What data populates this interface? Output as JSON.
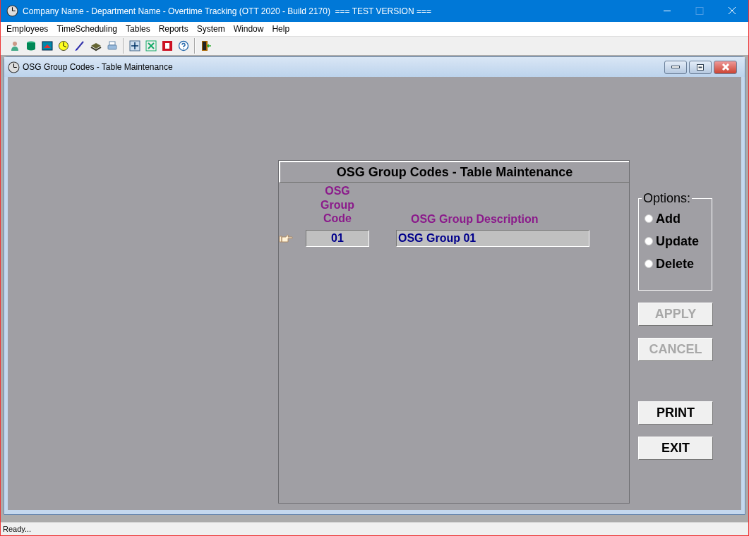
{
  "window": {
    "title": "Company Name - Department Name - Overtime Tracking (OTT 2020 - Build 2170)  === TEST VERSION ==="
  },
  "menu": [
    "Employees",
    "TimeScheduling",
    "Tables",
    "Reports",
    "System",
    "Window",
    "Help"
  ],
  "child_window": {
    "title": "OSG Group Codes - Table Maintenance"
  },
  "form": {
    "heading": "OSG Group Codes - Table Maintenance",
    "columns": [
      "OSG Group Code",
      "OSG Group Description"
    ],
    "rows": [
      {
        "code": "01",
        "description": "OSG Group 01",
        "current": true
      }
    ]
  },
  "options": {
    "legend": "Options:",
    "items": [
      {
        "label": "Add",
        "selected": false
      },
      {
        "label": "Update",
        "selected": false
      },
      {
        "label": "Delete",
        "selected": false
      }
    ]
  },
  "buttons": [
    {
      "label": "APPLY",
      "disabled": true
    },
    {
      "label": "CANCEL",
      "disabled": true
    },
    {
      "label": "PRINT",
      "disabled": false
    },
    {
      "label": "EXIT",
      "disabled": false
    }
  ],
  "status_bar": "Ready..."
}
